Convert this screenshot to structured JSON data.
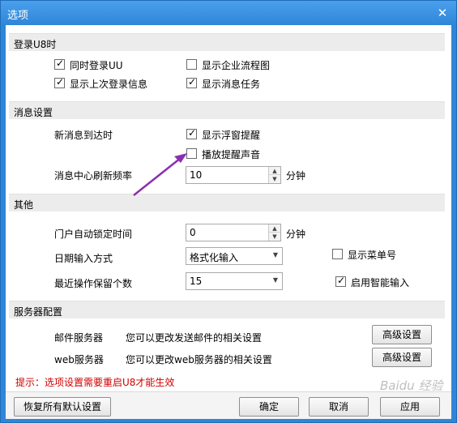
{
  "window": {
    "title": "选项",
    "close_glyph": "✕"
  },
  "login": {
    "header": "登录U8时",
    "simultaneous_login": {
      "label": "同时登录UU",
      "checked": true
    },
    "show_enterprise_flow": {
      "label": "显示企业流程图",
      "checked": false
    },
    "show_last_login": {
      "label": "显示上次登录信息",
      "checked": true
    },
    "show_message_tasks": {
      "label": "显示消息任务",
      "checked": true
    }
  },
  "messages": {
    "header": "消息设置",
    "arrival_label": "新消息到达时",
    "floating_popup": {
      "label": "显示浮窗提醒",
      "checked": true
    },
    "play_sound": {
      "label": "播放提醒声音",
      "checked": false
    },
    "refresh_label": "消息中心刷新频率",
    "refresh_value": "10",
    "refresh_unit": "分钟"
  },
  "other": {
    "header": "其他",
    "auto_lock_label": "门户自动锁定时间",
    "auto_lock_value": "0",
    "auto_lock_unit": "分钟",
    "date_input_label": "日期输入方式",
    "date_input_value": "格式化输入",
    "recent_ops_label": "最近操作保留个数",
    "recent_ops_value": "15",
    "show_menu_no": {
      "label": "显示菜单号",
      "checked": false
    },
    "smart_input": {
      "label": "启用智能输入",
      "checked": true
    }
  },
  "server": {
    "header": "服务器配置",
    "mail_label": "邮件服务器",
    "mail_desc": "您可以更改发送邮件的相关设置",
    "mail_button": "高级设置",
    "web_label": "web服务器",
    "web_desc": "您可以更改web服务器的相关设置",
    "web_button": "高级设置"
  },
  "hint": "提示：选项设置需要重启U8才能生效",
  "footer": {
    "restore_defaults": "恢复所有默认设置",
    "ok": "确定",
    "cancel": "取消",
    "apply": "应用"
  },
  "watermark": "Baidu 经验",
  "colors": {
    "title_bar": "#2f86d8",
    "hint_text": "#d00000",
    "section_bg": "#ececec",
    "annotation_arrow": "#8b2fb0"
  }
}
